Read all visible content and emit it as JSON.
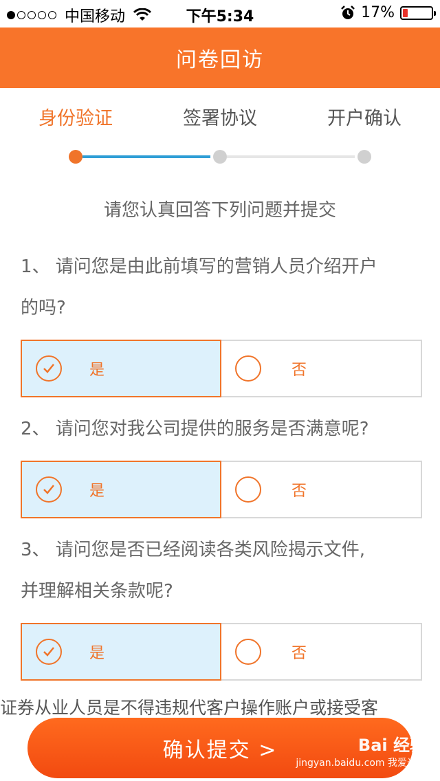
{
  "status_bar": {
    "carrier": "中国移动",
    "time": "下午5:34",
    "battery_text": "17%",
    "battery_level": 0.17,
    "signal_dots": [
      true,
      false,
      false,
      false,
      false
    ]
  },
  "header": {
    "title": "问卷回访"
  },
  "steps": {
    "items": [
      {
        "label": "身份验证",
        "active": true
      },
      {
        "label": "签署协议",
        "active": false
      },
      {
        "label": "开户确认",
        "active": false
      }
    ]
  },
  "instruction": "请您认真回答下列问题并提交",
  "questions": [
    {
      "line1": "1、 请问您是由此前填写的营销人员介绍开户",
      "line2": "的吗?",
      "yes": "是",
      "no": "否",
      "selected": "yes"
    },
    {
      "line1": "2、 请问您对我公司提供的服务是否满意呢?",
      "line2": "",
      "yes": "是",
      "no": "否",
      "selected": "yes"
    },
    {
      "line1": "3、 请问您是否已经阅读各类风险揭示文件,",
      "line2": "并理解相关条款呢?",
      "yes": "是",
      "no": "否",
      "selected": "yes"
    }
  ],
  "notice": "证券从业人员是不得违规代客户操作账户或接受客",
  "submit": {
    "label": "确认提交 >"
  },
  "watermark": {
    "top": "Bai 经验",
    "bottom": "jingyan.baidu.com 我爱光头阳"
  },
  "colors": {
    "accent": "#f8742a",
    "selected_bg": "#ddf1fc",
    "progress_blue": "#2f9ed6"
  }
}
